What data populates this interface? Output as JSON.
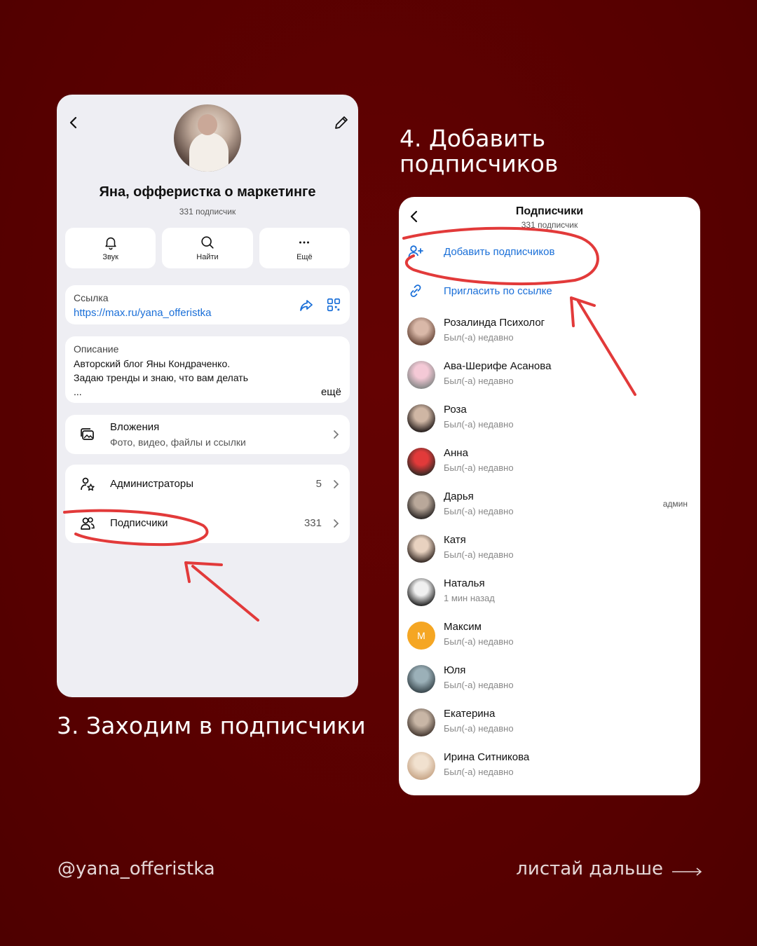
{
  "colors": {
    "background": "#5a0000",
    "accent_blue": "#1a6fd8",
    "annotation_red": "#e23a3a"
  },
  "left_screen": {
    "profile_name": "Яна, офферистка о маркетинге",
    "profile_subtitle": "331 подписчик",
    "actions": [
      {
        "icon": "bell-icon",
        "label": "Звук"
      },
      {
        "icon": "search-icon",
        "label": "Найти"
      },
      {
        "icon": "more-icon",
        "label": "Ещё"
      }
    ],
    "link": {
      "label": "Ссылка",
      "url": "https://max.ru/yana_offeristka"
    },
    "description": {
      "label": "Описание",
      "line1": "Авторский блог Яны Кондраченко.",
      "line2": "Задаю тренды и знаю, что вам делать",
      "line3": "...",
      "more": "ещё"
    },
    "attachments": {
      "title": "Вложения",
      "subtitle": "Фото, видео, файлы и ссылки"
    },
    "admins": {
      "title": "Администраторы",
      "count": "5"
    },
    "subscribers": {
      "title": "Подписчики",
      "count": "331"
    }
  },
  "step3_caption": "3. Заходим в подписчики",
  "step4_caption_line1": "4. Добавить",
  "step4_caption_line2": "подписчиков",
  "right_screen": {
    "title": "Подписчики",
    "subtitle": "331 подписчик",
    "add_subscribers": "Добавить подписчиков",
    "invite_link": "Пригласить по ссылке",
    "subscribers": [
      {
        "name": "Розалинда Психолог",
        "status": "Был(-а) недавно",
        "badge": ""
      },
      {
        "name": "Ава-Шерифе Асанова",
        "status": "Был(-а) недавно",
        "badge": ""
      },
      {
        "name": "Роза",
        "status": "Был(-а) недавно",
        "badge": ""
      },
      {
        "name": "Анна",
        "status": "Был(-а) недавно",
        "badge": ""
      },
      {
        "name": "Дарья",
        "status": "Был(-а) недавно",
        "badge": "админ"
      },
      {
        "name": "Катя",
        "status": "Был(-а) недавно",
        "badge": ""
      },
      {
        "name": "Наталья",
        "status": "1 мин назад",
        "badge": ""
      },
      {
        "name": "Максим",
        "status": "Был(-а) недавно",
        "badge": "",
        "initial": "М"
      },
      {
        "name": "Юля",
        "status": "Был(-а) недавно",
        "badge": ""
      },
      {
        "name": "Екатерина",
        "status": "Был(-а) недавно",
        "badge": ""
      },
      {
        "name": "Ирина Ситникова",
        "status": "Был(-а) недавно",
        "badge": ""
      }
    ]
  },
  "footer": {
    "handle": "@yana_offeristka",
    "next": "листай дальше"
  }
}
